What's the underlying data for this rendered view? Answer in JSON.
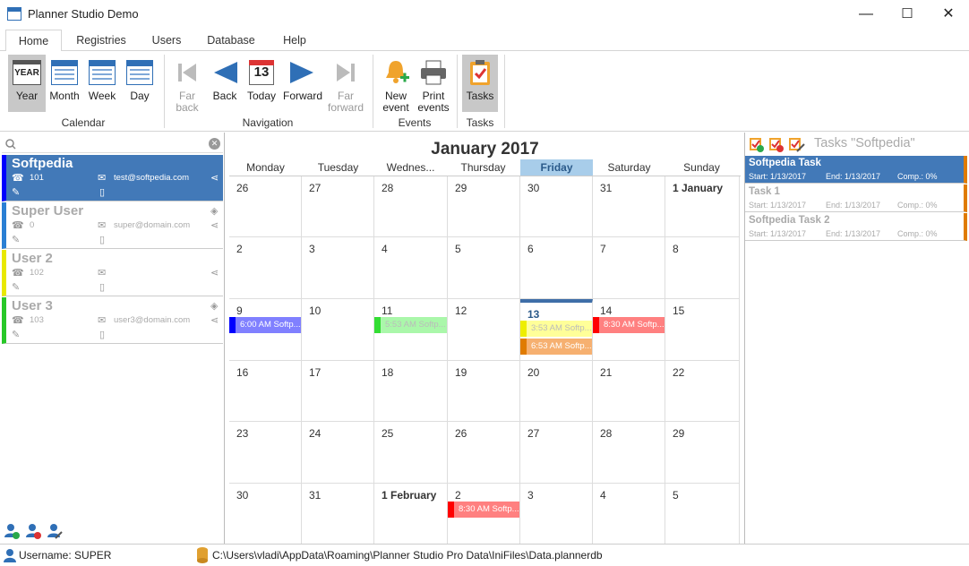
{
  "window": {
    "title": "Planner Studio Demo",
    "minimize": "—",
    "maximize": "☐",
    "close": "✕"
  },
  "tabs": [
    "Home",
    "Registries",
    "Users",
    "Database",
    "Help"
  ],
  "ribbon": {
    "calendar_group": "Calendar",
    "navigation_group": "Navigation",
    "events_group": "Events",
    "tasks_group": "Tasks",
    "year_icon_text": "YEAR",
    "today_icon_text": "13",
    "year": "Year",
    "month": "Month",
    "week": "Week",
    "day": "Day",
    "far_back": "Far\nback",
    "back": "Back",
    "today": "Today",
    "forward": "Forward",
    "far_forward": "Far\nforward",
    "new_event": "New\nevent",
    "print_events": "Print\nevents",
    "tasks": "Tasks"
  },
  "users": [
    {
      "name": "Softpedia",
      "phone": "101",
      "email": "test@softpedia.com",
      "color": "#0000ff"
    },
    {
      "name": "Super User",
      "phone": "0",
      "email": "super@domain.com",
      "color": "#2a7fd4"
    },
    {
      "name": "User 2",
      "phone": "102",
      "email": "",
      "color": "#e8e800"
    },
    {
      "name": "User 3",
      "phone": "103",
      "email": "user3@domain.com",
      "color": "#28c828"
    }
  ],
  "calendar": {
    "title": "January 2017",
    "weekdays": [
      "Monday",
      "Tuesday",
      "Wednes...",
      "Thursday",
      "Friday",
      "Saturday",
      "Sunday"
    ],
    "weeks": [
      [
        "26",
        "27",
        "28",
        "29",
        "30",
        "31",
        "1 January"
      ],
      [
        "2",
        "3",
        "4",
        "5",
        "6",
        "7",
        "8"
      ],
      [
        "9",
        "10",
        "11",
        "12",
        "13",
        "14",
        "15"
      ],
      [
        "16",
        "17",
        "18",
        "19",
        "20",
        "21",
        "22"
      ],
      [
        "23",
        "24",
        "25",
        "26",
        "27",
        "28",
        "29"
      ],
      [
        "30",
        "31",
        "1 February",
        "2",
        "3",
        "4",
        "5"
      ]
    ],
    "events": {
      "e1": "6:00 AM Softp...",
      "e2": "5:53 AM Softp...",
      "e3": "3:53 AM Softp...",
      "e4": "6:53 AM Softp...",
      "e5": "8:30 AM Softp...",
      "e6": "8:30 AM Softp..."
    }
  },
  "tasks": {
    "header": "Tasks \"Softpedia\"",
    "items": [
      {
        "name": "Softpedia Task",
        "start": "Start: 1/13/2017",
        "end": "End: 1/13/2017",
        "comp": "Comp.: 0%"
      },
      {
        "name": "Task 1",
        "start": "Start: 1/13/2017",
        "end": "End: 1/13/2017",
        "comp": "Comp.: 0%"
      },
      {
        "name": "Softpedia Task 2",
        "start": "Start: 1/13/2017",
        "end": "End: 1/13/2017",
        "comp": "Comp.: 0%"
      }
    ]
  },
  "status": {
    "username": "Username: SUPER",
    "path": "C:\\Users\\vladi\\AppData\\Roaming\\Planner Studio Pro Data\\IniFiles\\Data.plannerdb"
  }
}
